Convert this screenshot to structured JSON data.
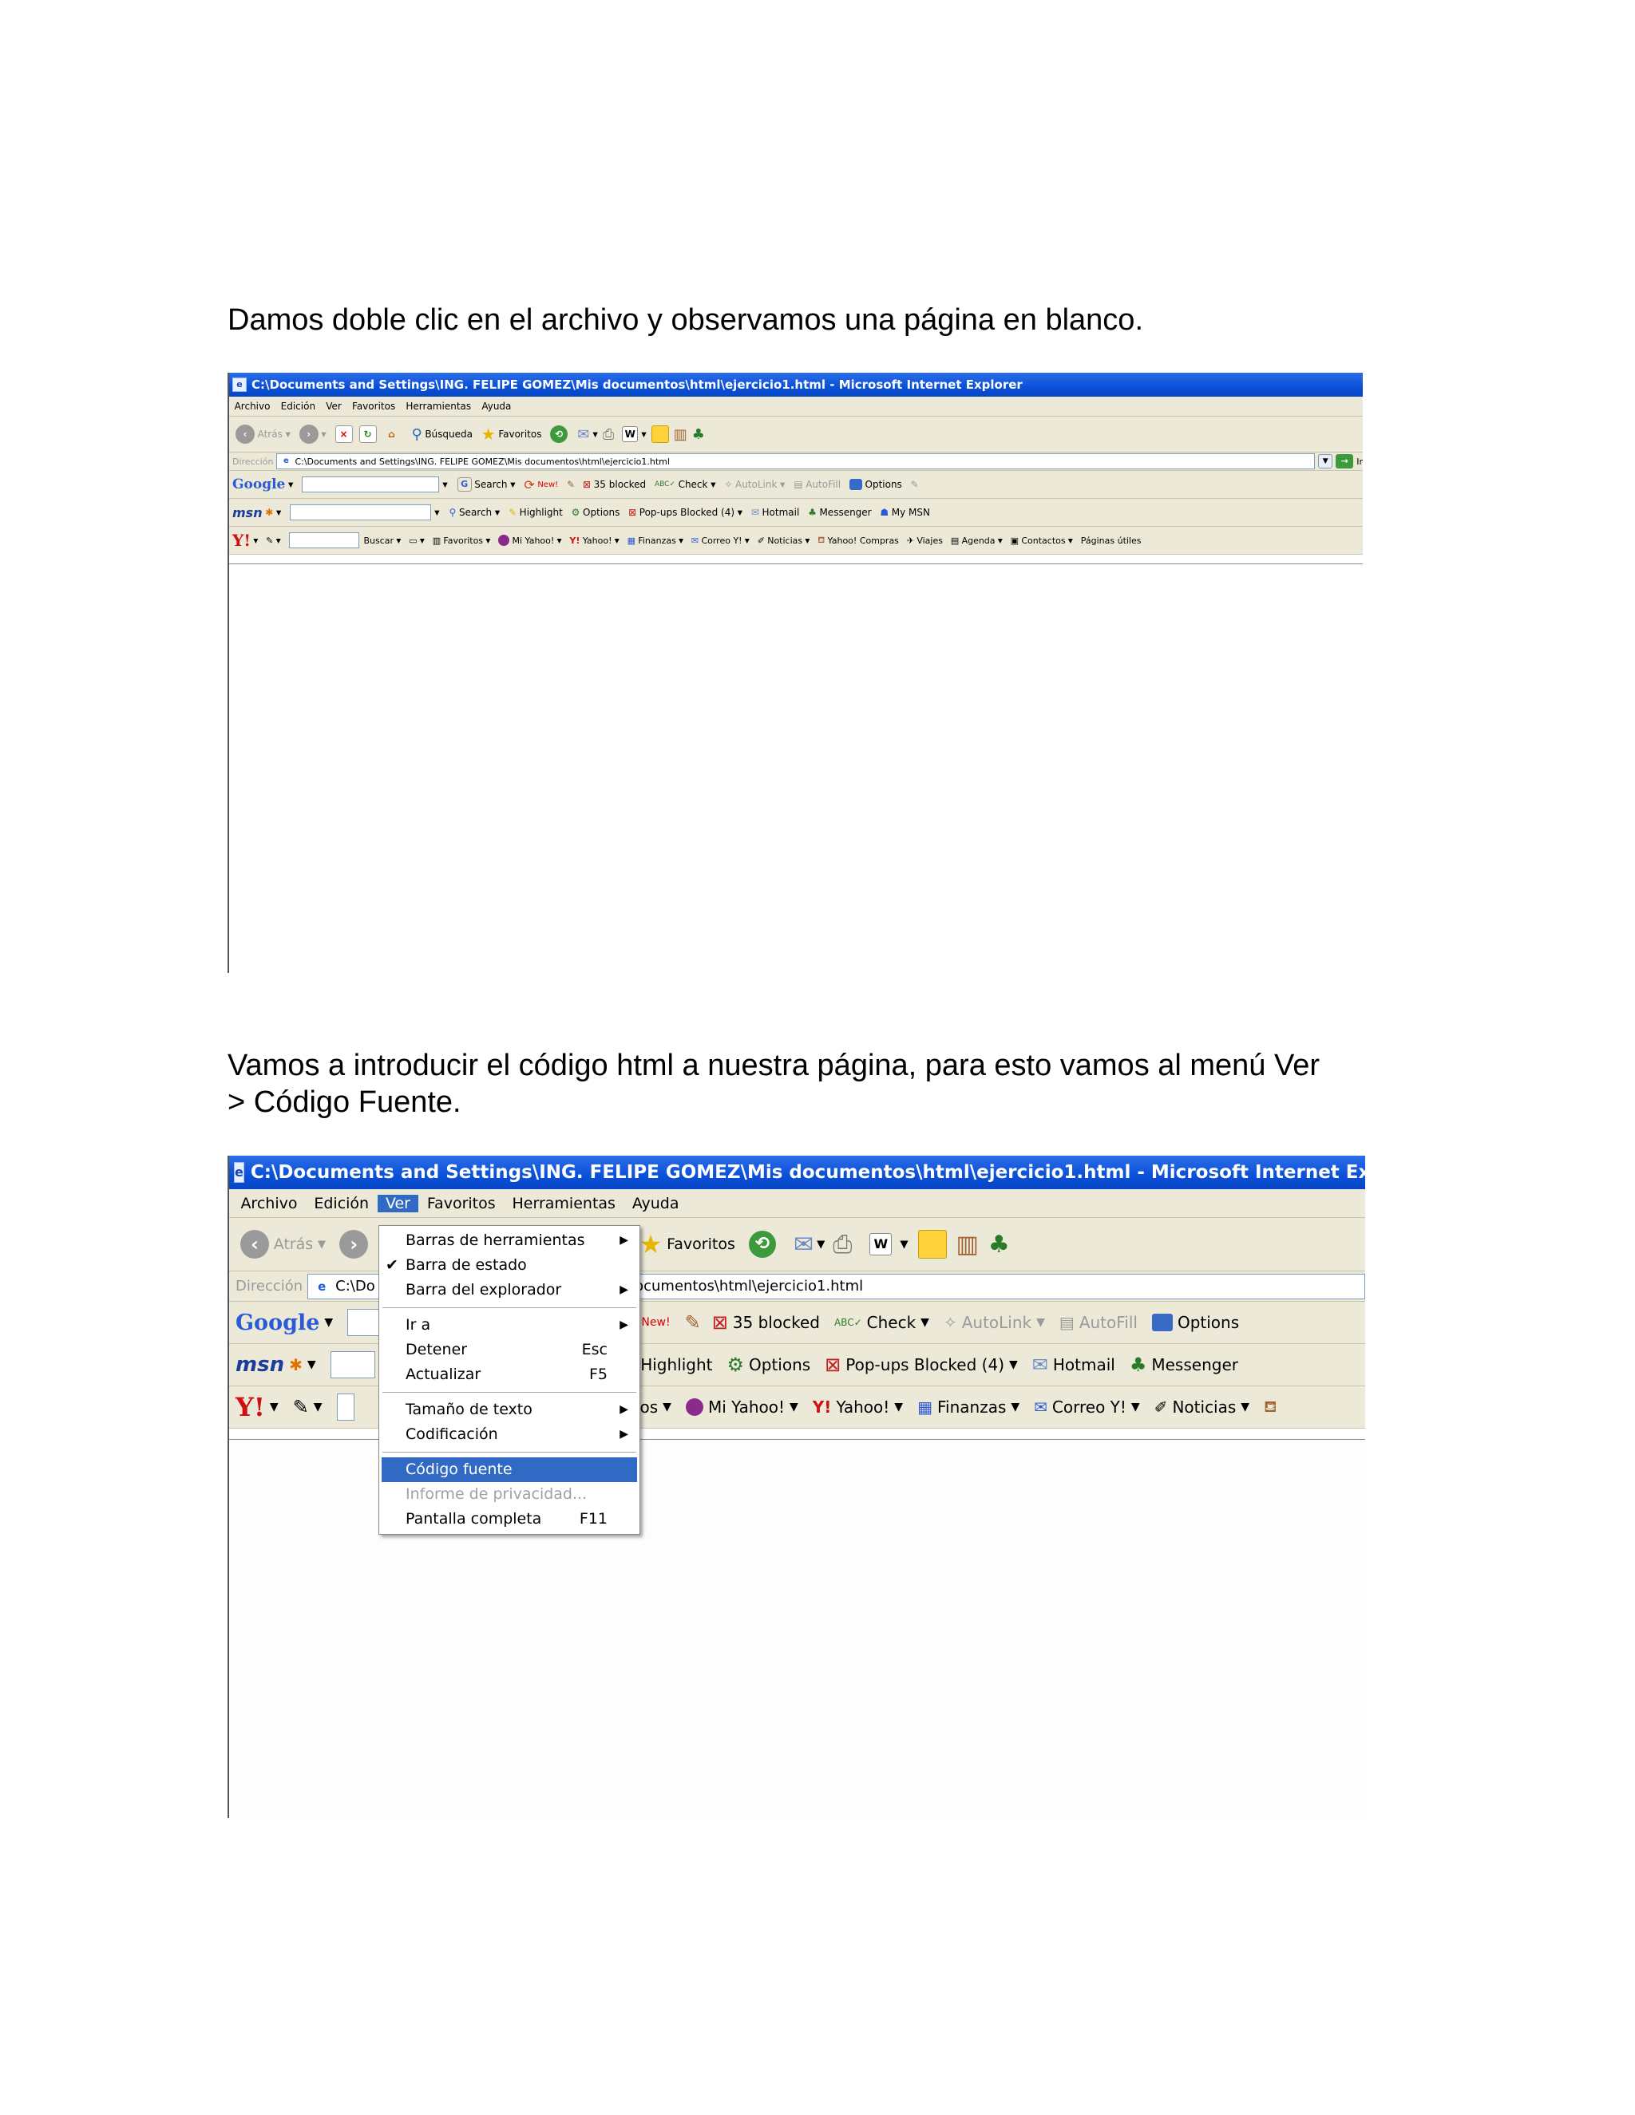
{
  "paragraphs": {
    "p1": "Damos doble clic en el archivo y observamos una página en blanco.",
    "p2_line1": "Vamos a introducir el código html a nuestra página, para esto vamos al menú Ver",
    "p2_line2": "> Código Fuente."
  },
  "window": {
    "title": "C:\\Documents and Settings\\ING. FELIPE GOMEZ\\Mis documentos\\html\\ejercicio1.html - Microsoft Internet Explorer",
    "address_label": "Dirección",
    "address_value": "C:\\Documents and Settings\\ING. FELIPE GOMEZ\\Mis documentos\\html\\ejercicio1.html",
    "address_partial_left": "C:\\Do",
    "address_partial_right": "MEZ\\Mis documentos\\html\\ejercicio1.html",
    "address_go": "Ir"
  },
  "menubar": [
    "Archivo",
    "Edición",
    "Ver",
    "Favoritos",
    "Herramientas",
    "Ayuda"
  ],
  "toolbar": {
    "back": "Atrás",
    "search": "Búsqueda",
    "search_partial": "ueda",
    "favorites": "Favoritos"
  },
  "google_bar": {
    "logo": "Google",
    "search": "Search",
    "new_badge": "New!",
    "blocked": "35 blocked",
    "check": "Check",
    "autolink": "AutoLink",
    "autofill": "AutoFill",
    "options": "Options"
  },
  "msn_bar": {
    "logo": "msn",
    "search": "Search",
    "search_partial": "ch",
    "highlight": "Highlight",
    "options": "Options",
    "popups": "Pop-ups Blocked (4)",
    "hotmail": "Hotmail",
    "messenger": "Messenger",
    "mymsn": "My MSN"
  },
  "yahoo_bar": {
    "logo": "Y!",
    "buscar": "Buscar",
    "favoritos": "Favoritos",
    "favoritos_partial": "avoritos",
    "mi_yahoo": "Mi Yahoo!",
    "yahoo": "Yahoo!",
    "finanzas": "Finanzas",
    "correo": "Correo Y!",
    "noticias": "Noticias",
    "compras": "Yahoo! Compras",
    "viajes": "Viajes",
    "agenda": "Agenda",
    "contactos": "Contactos",
    "paginas": "Páginas útiles"
  },
  "ver_menu": {
    "barras_herramientas": "Barras de herramientas",
    "barra_estado": "Barra de estado",
    "barra_explorador": "Barra del explorador",
    "ir_a": "Ir a",
    "detener": "Detener",
    "detener_key": "Esc",
    "actualizar": "Actualizar",
    "actualizar_key": "F5",
    "tamano_texto": "Tamaño de texto",
    "codificacion": "Codificación",
    "codigo_fuente": "Código fuente",
    "informe_privacidad": "Informe de privacidad...",
    "pantalla_completa": "Pantalla completa",
    "pantalla_completa_key": "F11"
  }
}
